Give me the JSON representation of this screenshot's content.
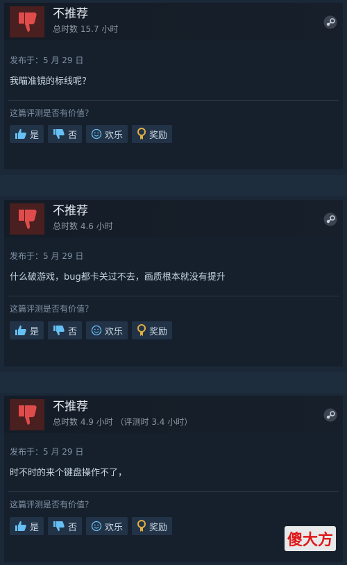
{
  "reviews": [
    {
      "verdict": "不推荐",
      "hours": "总时数 15.7 小时",
      "posted": "发布于：5 月 29 日",
      "content": "我瞄准镜的标线呢？",
      "helpful_prompt": "这篇评测是否有价值？"
    },
    {
      "verdict": "不推荐",
      "hours": "总时数 4.6 小时",
      "posted": "发布于：5 月 29 日",
      "content": "什么破游戏，bug都卡关过不去，画质根本就没有提升",
      "helpful_prompt": "这篇评测是否有价值？"
    },
    {
      "verdict": "不推荐",
      "hours": "总时数 4.9 小时 （评测时 3.4 小时）",
      "posted": "发布于：5 月 29 日",
      "content": "时不时的来个键盘操作不了，",
      "helpful_prompt": "这篇评测是否有价值？"
    }
  ],
  "buttons": {
    "yes": "是",
    "no": "否",
    "funny": "欢乐",
    "award": "奖励"
  },
  "watermark": "傻大方",
  "colors": {
    "background": "#1b2838",
    "thumb_down": "#e04c4c",
    "button_bg": "#223348",
    "accent_blue": "#66c0f4",
    "award_gold": "#e0b040"
  }
}
